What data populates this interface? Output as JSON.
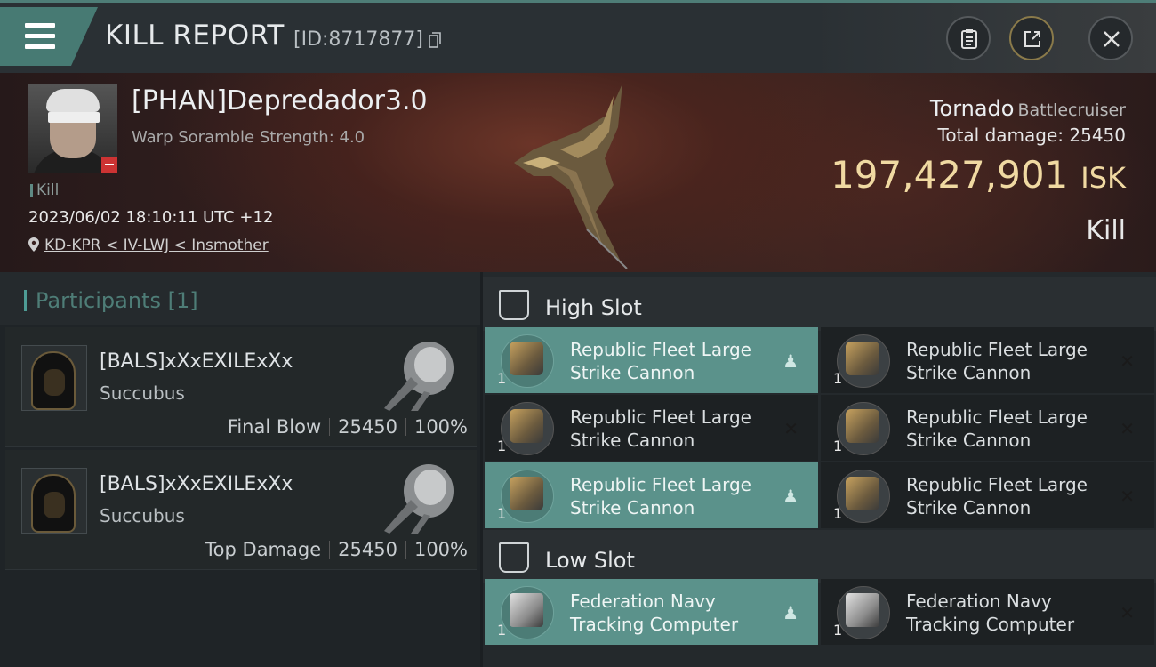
{
  "header": {
    "title": "KILL REPORT",
    "id_text": "[ID:8717877]"
  },
  "victim": {
    "name": "[PHAN]Depredador3.0",
    "scramble": "Warp Soramble Strength: 4.0",
    "kill_tag": "Kill",
    "datetime": "2023/06/02 18:10:11 UTC +12",
    "location": "KD-KPR < IV-LWJ < Insmother",
    "ship_name": "Tornado",
    "ship_class": "Battlecruiser",
    "total_damage_label": "Total damage:",
    "total_damage": "25450",
    "isk_value": "197,427,901",
    "isk_unit": "ISK",
    "result": "Kill"
  },
  "participants": {
    "label": "Participants",
    "count": "[1]",
    "items": [
      {
        "name": "[BALS]xXxEXILExXx",
        "ship": "Succubus",
        "role": "Final Blow",
        "damage": "25450",
        "percent": "100%"
      },
      {
        "name": "[BALS]xXxEXILExXx",
        "ship": "Succubus",
        "role": "Top Damage",
        "damage": "25450",
        "percent": "100%"
      }
    ]
  },
  "high_slot": {
    "label": "High Slot",
    "items": [
      {
        "line1": "Republic Fleet Large",
        "line2": "Strike Cannon",
        "qty": "1",
        "state": "dropped"
      },
      {
        "line1": "Republic Fleet Large",
        "line2": "Strike Cannon",
        "qty": "1",
        "state": "destroyed"
      },
      {
        "line1": "Republic Fleet Large",
        "line2": "Strike Cannon",
        "qty": "1",
        "state": "destroyed"
      },
      {
        "line1": "Republic Fleet Large",
        "line2": "Strike Cannon",
        "qty": "1",
        "state": "destroyed"
      },
      {
        "line1": "Republic Fleet Large",
        "line2": "Strike Cannon",
        "qty": "1",
        "state": "dropped"
      },
      {
        "line1": "Republic Fleet Large",
        "line2": "Strike Cannon",
        "qty": "1",
        "state": "destroyed"
      }
    ]
  },
  "low_slot": {
    "label": "Low Slot",
    "items": [
      {
        "line1": "Federation Navy",
        "line2": "Tracking Computer",
        "qty": "1",
        "state": "dropped"
      },
      {
        "line1": "Federation Navy",
        "line2": "Tracking Computer",
        "qty": "1",
        "state": "destroyed"
      }
    ]
  },
  "colors": {
    "accent": "#5b928b",
    "isk": "#f0d9a2"
  }
}
